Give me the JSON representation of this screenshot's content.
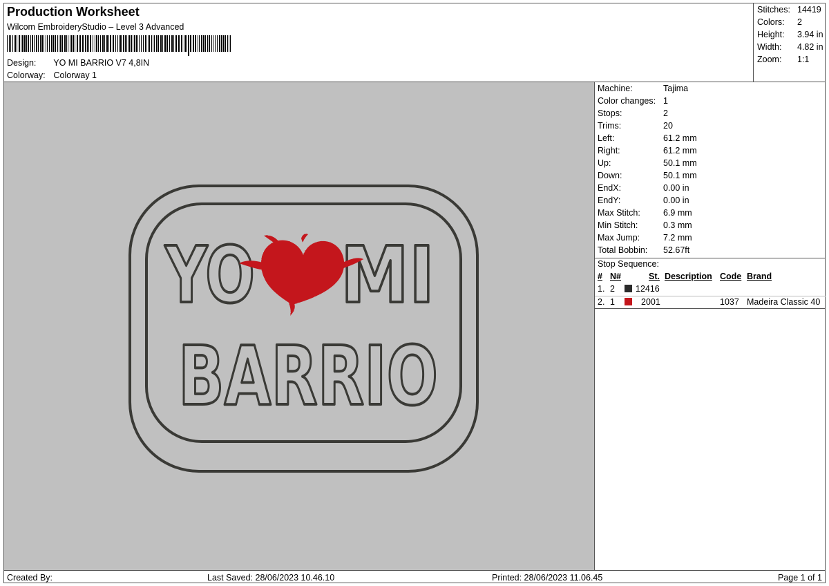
{
  "header": {
    "title": "Production Worksheet",
    "software": "Wilcom EmbroideryStudio – Level 3 Advanced",
    "design_label": "Design:",
    "design_value": "YO MI BARRIO V7 4,8IN",
    "colorway_label": "Colorway:",
    "colorway_value": "Colorway 1"
  },
  "stats": {
    "stitches_label": "Stitches:",
    "stitches": "14419",
    "colors_label": "Colors:",
    "colors": "2",
    "height_label": "Height:",
    "height": "3.94 in",
    "width_label": "Width:",
    "width": "4.82 in",
    "zoom_label": "Zoom:",
    "zoom": "1:1"
  },
  "machine": {
    "rows": [
      {
        "label": "Machine:",
        "value": "Tajima"
      },
      {
        "label": "Color changes:",
        "value": "1"
      },
      {
        "label": "Stops:",
        "value": "2"
      },
      {
        "label": "Trims:",
        "value": "20"
      },
      {
        "label": "Left:",
        "value": "61.2 mm"
      },
      {
        "label": "Right:",
        "value": "61.2 mm"
      },
      {
        "label": "Up:",
        "value": "50.1 mm"
      },
      {
        "label": "Down:",
        "value": "50.1 mm"
      },
      {
        "label": "EndX:",
        "value": "0.00 in"
      },
      {
        "label": "EndY:",
        "value": "0.00 in"
      },
      {
        "label": "Max Stitch:",
        "value": "6.9 mm"
      },
      {
        "label": "Min Stitch:",
        "value": "0.3 mm"
      },
      {
        "label": "Max Jump:",
        "value": "7.2 mm"
      },
      {
        "label": "Total Bobbin:",
        "value": "52.67ft"
      }
    ]
  },
  "stop_sequence": {
    "title": "Stop Sequence:",
    "headers": {
      "hash": "#",
      "n": "N#",
      "st": "St.",
      "description": "Description",
      "code": "Code",
      "brand": "Brand"
    },
    "rows": [
      {
        "num": "1.",
        "n": "2",
        "color": "#2b2b2b",
        "st": "12416",
        "description": "",
        "code": "",
        "brand": ""
      },
      {
        "num": "2.",
        "n": "1",
        "color": "#c4161c",
        "st": "2001",
        "description": "",
        "code": "1037",
        "brand": "Madeira Classic 40"
      }
    ]
  },
  "design": {
    "line1_left": "YO",
    "line1_right": "MI",
    "line2": "BARRIO",
    "thread_dark": "#3a3a36",
    "thread_red": "#c4161c",
    "background": "#c0c0c0"
  },
  "footer": {
    "created_by": "Created By:",
    "last_saved": "Last Saved: 28/06/2023 10.46.10",
    "printed": "Printed: 28/06/2023 11.06.45",
    "page": "Page 1 of 1"
  }
}
